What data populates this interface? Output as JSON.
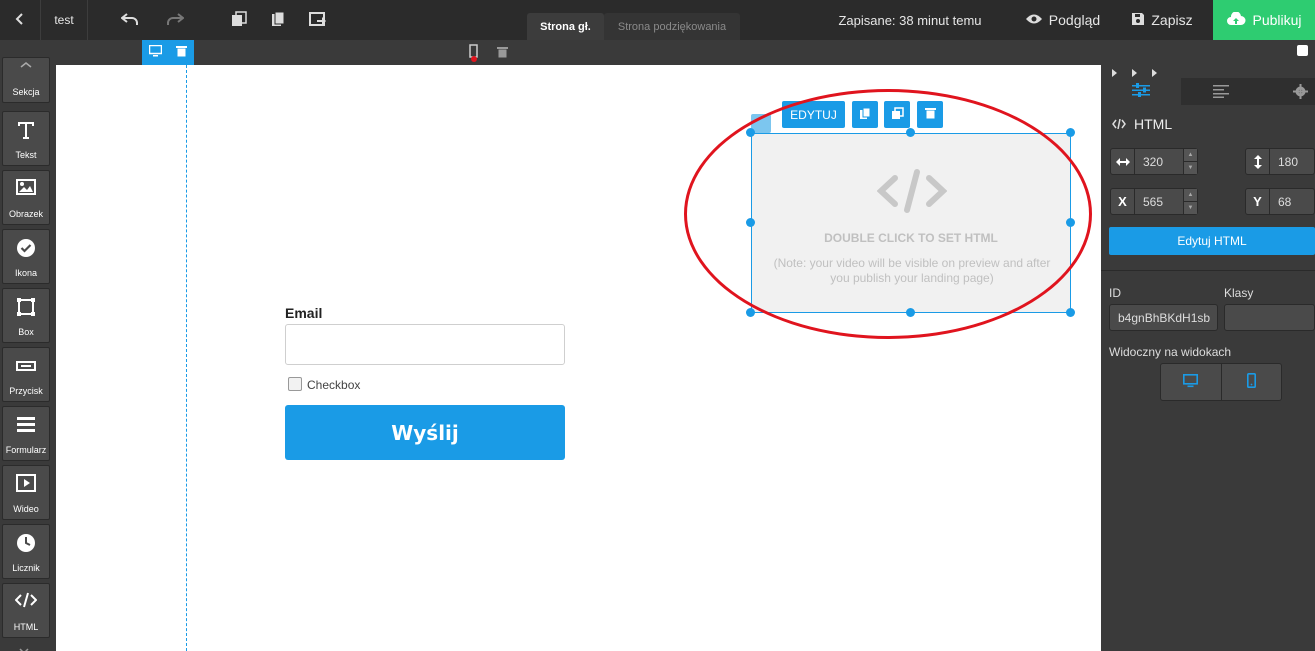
{
  "topbar": {
    "project_name": "test",
    "tabs": [
      {
        "label": "Strona gł.",
        "active": true
      },
      {
        "label": "Strona podziękowania",
        "active": false
      }
    ],
    "saved_status": "Zapisane: 38 minut temu",
    "preview_label": "Podgląd",
    "save_label": "Zapisz",
    "publish_label": "Publikuj"
  },
  "tools": [
    {
      "label": "Sekcja",
      "icon": "section-icon"
    },
    {
      "label": "Tekst",
      "icon": "text-icon"
    },
    {
      "label": "Obrazek",
      "icon": "image-icon"
    },
    {
      "label": "Ikona",
      "icon": "check-circle-icon"
    },
    {
      "label": "Box",
      "icon": "box-icon"
    },
    {
      "label": "Przycisk",
      "icon": "button-icon"
    },
    {
      "label": "Formularz",
      "icon": "form-icon"
    },
    {
      "label": "Wideo",
      "icon": "video-icon"
    },
    {
      "label": "Licznik",
      "icon": "clock-icon"
    },
    {
      "label": "HTML",
      "icon": "code-icon"
    }
  ],
  "form": {
    "email_label": "Email",
    "email_value": "",
    "checkbox_label": "Checkbox",
    "submit_label": "Wyślij"
  },
  "html_element": {
    "edit_label": "EDYTUJ",
    "title": "DOUBLE CLICK TO SET HTML",
    "note": "(Note: your video will be visible on  preview and after you publish your landing page)"
  },
  "panel": {
    "section_title": "HTML",
    "width": "320",
    "height": "180",
    "x_label": "X",
    "x": "565",
    "y_label": "Y",
    "y": "68",
    "edit_html_label": "Edytuj HTML",
    "id_label": "ID",
    "id_value": "b4gnBhBKdH1sb",
    "classes_label": "Klasy",
    "classes_value": "",
    "visible_label": "Widoczny na widokach"
  },
  "colors": {
    "accent": "#1a9be6",
    "publish": "#2ecc71",
    "highlight": "#e0141e"
  }
}
